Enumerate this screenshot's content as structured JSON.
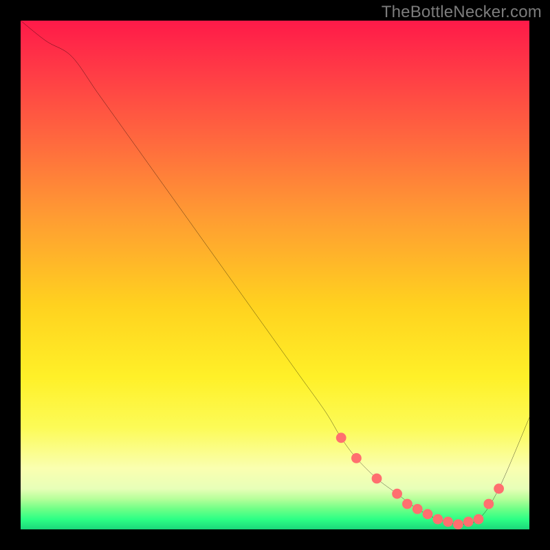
{
  "watermark": "TheBottleNecker.com",
  "gradient_colors": {
    "top": "#ff1a49",
    "mid_high": "#ff9a33",
    "mid": "#fff028",
    "low": "#faffb0",
    "band_green_light": "#b6ff9a",
    "band_green": "#2dff85",
    "bottom": "#1bd67a"
  },
  "chart_data": {
    "type": "line",
    "title": "",
    "xlabel": "",
    "ylabel": "",
    "xlim": [
      0,
      100
    ],
    "ylim": [
      0,
      100
    ],
    "grid": false,
    "legend": false,
    "series": [
      {
        "name": "bottleneck-curve",
        "x": [
          0,
          5,
          10,
          15,
          20,
          25,
          30,
          35,
          40,
          45,
          50,
          55,
          60,
          63,
          66,
          70,
          74,
          78,
          82,
          86,
          90,
          94,
          100
        ],
        "y": [
          100,
          96,
          93,
          86,
          79,
          72,
          65,
          58,
          51,
          44,
          37,
          30,
          23,
          18,
          14,
          10,
          7,
          4,
          2,
          1,
          2,
          8,
          22
        ],
        "color": "#000000"
      }
    ],
    "markers": {
      "name": "hotspot-dots",
      "color": "#ff6f6f",
      "radius": 1.0,
      "points": [
        {
          "x": 63,
          "y": 18
        },
        {
          "x": 66,
          "y": 14
        },
        {
          "x": 70,
          "y": 10
        },
        {
          "x": 74,
          "y": 7
        },
        {
          "x": 76,
          "y": 5
        },
        {
          "x": 78,
          "y": 4
        },
        {
          "x": 80,
          "y": 3
        },
        {
          "x": 82,
          "y": 2
        },
        {
          "x": 84,
          "y": 1.5
        },
        {
          "x": 86,
          "y": 1
        },
        {
          "x": 88,
          "y": 1.5
        },
        {
          "x": 90,
          "y": 2
        },
        {
          "x": 92,
          "y": 5
        },
        {
          "x": 94,
          "y": 8
        }
      ]
    }
  }
}
